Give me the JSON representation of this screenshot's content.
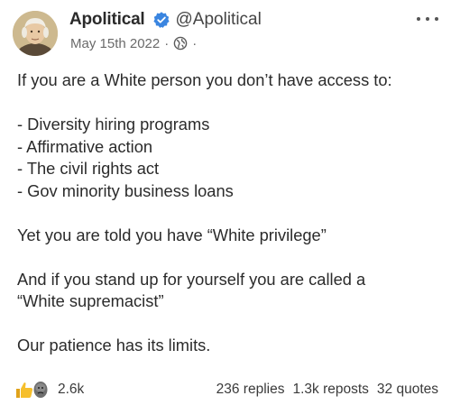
{
  "author": {
    "display_name": "Apolitical",
    "handle": "@Apolitical",
    "verified": true,
    "avatar_icon": "portrait-avatar"
  },
  "meta": {
    "date": "May 15th 2022",
    "separator": "·",
    "visibility_icon": "globe-icon",
    "trailing_separator": "·"
  },
  "more_icon": "ellipsis-icon",
  "post": {
    "paragraphs": [
      [
        "If you are a White person you don’t have access to:"
      ],
      [
        "- Diversity hiring programs",
        "- Affirmative action",
        "- The civil rights act",
        "- Gov minority business loans"
      ],
      [
        "Yet you are told you have “White privilege”"
      ],
      [
        "And if you stand up for yourself you are called a",
        "“White supremacist”"
      ],
      [
        "Our patience has its limits."
      ]
    ]
  },
  "footer": {
    "reaction_icons": [
      "thumbs-up-icon",
      "dislike-face-icon"
    ],
    "reaction_count": "2.6k",
    "replies": "236 replies",
    "reposts": "1.3k reposts",
    "quotes": "32 quotes"
  },
  "colors": {
    "verified_badge": "#3a85e0",
    "text": "#2b2b2b",
    "muted": "#6a6a6a"
  }
}
